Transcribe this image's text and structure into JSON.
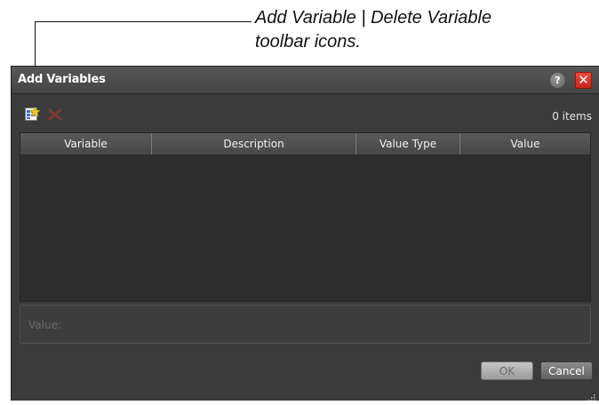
{
  "callout": {
    "line1": "Add Variable | Delete Variable",
    "line2": "toolbar icons."
  },
  "dialog": {
    "title": "Add Variables",
    "help_label": "?",
    "close_label": "✕"
  },
  "toolbar": {
    "add_icon": "add-variable-icon",
    "delete_icon": "delete-variable-icon",
    "items_count": "0 items"
  },
  "table": {
    "columns": [
      "Variable",
      "Description",
      "Value Type",
      "Value"
    ],
    "rows": []
  },
  "value_field": {
    "label": "Value:"
  },
  "buttons": {
    "ok": "OK",
    "cancel": "Cancel"
  },
  "colors": {
    "dialog_bg": "#3b3b3b",
    "titlebar": "#4e4e4e",
    "close_red": "#d9331f"
  }
}
